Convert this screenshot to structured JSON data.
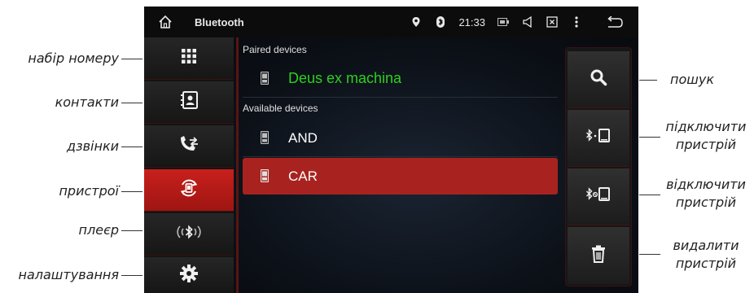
{
  "statusbar": {
    "title": "Bluetooth",
    "time": "21:33",
    "icons": [
      "home-icon",
      "location-icon",
      "bluetooth-icon",
      "battery-icon",
      "volume-icon",
      "close-window-icon",
      "more-vert-icon",
      "back-icon"
    ]
  },
  "sidebar": {
    "items": [
      {
        "icon": "dialpad-icon",
        "callout": "набір номеру"
      },
      {
        "icon": "contacts-icon",
        "callout": "контакти"
      },
      {
        "icon": "call-log-icon",
        "callout": "дзвінки"
      },
      {
        "icon": "devices-icon",
        "callout": "пристрої",
        "active": true
      },
      {
        "icon": "bt-music-icon",
        "callout": "плеєр"
      },
      {
        "icon": "settings-icon",
        "callout": "налаштування"
      }
    ]
  },
  "devices": {
    "paired_header": "Paired devices",
    "paired": [
      {
        "name": "Deus ex machina"
      }
    ],
    "available_header": "Available devices",
    "available": [
      {
        "name": "AND"
      },
      {
        "name": "CAR",
        "selected": true
      }
    ]
  },
  "right_panel": {
    "buttons": [
      {
        "icon": "search-icon",
        "callout": "пошук"
      },
      {
        "icon": "connect-device-icon",
        "callout_line1": "підключити",
        "callout_line2": "пристрій"
      },
      {
        "icon": "disconnect-device-icon",
        "callout_line1": "відключити",
        "callout_line2": "пристрій"
      },
      {
        "icon": "delete-icon",
        "callout_line1": "видалити",
        "callout_line2": "пристрій"
      }
    ]
  },
  "colors": {
    "accent": "#a8231f",
    "paired_text": "#2ecf1f"
  }
}
